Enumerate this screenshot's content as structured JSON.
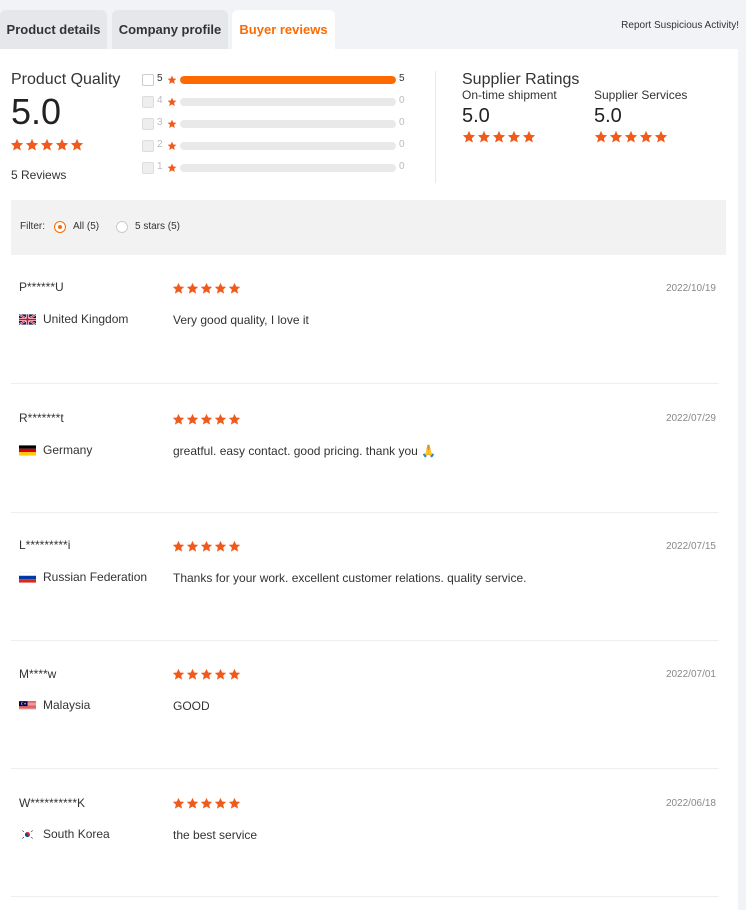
{
  "tabs": [
    {
      "label": "Product details"
    },
    {
      "label": "Company profile"
    },
    {
      "label": "Buyer reviews"
    }
  ],
  "report_link": "Report Suspicious Activity!",
  "product_quality": {
    "title": "Product Quality",
    "score": "5.0",
    "stars": 5,
    "reviews_count": "5 Reviews"
  },
  "distribution": [
    {
      "star": "5",
      "count": "5",
      "fraction": 1.0
    },
    {
      "star": "4",
      "count": "0",
      "fraction": 0
    },
    {
      "star": "3",
      "count": "0",
      "fraction": 0
    },
    {
      "star": "2",
      "count": "0",
      "fraction": 0
    },
    {
      "star": "1",
      "count": "0",
      "fraction": 0
    }
  ],
  "supplier_ratings": {
    "title": "Supplier Ratings",
    "items": [
      {
        "label": "On-time shipment",
        "score": "5.0",
        "stars": 5
      },
      {
        "label": "Supplier Services",
        "score": "5.0",
        "stars": 5
      }
    ]
  },
  "filter": {
    "label": "Filter:",
    "options": [
      {
        "label": "All (5)",
        "selected": true
      },
      {
        "label": "5 stars (5)",
        "selected": false
      }
    ]
  },
  "reviews": [
    {
      "name": "P******U",
      "country": "United Kingdom",
      "flag": "uk-flag-icon",
      "date": "2022/10/19",
      "text": "Very good quality, I love it",
      "stars": 5
    },
    {
      "name": "R*******t",
      "country": "Germany",
      "flag": "germany-flag-icon",
      "date": "2022/07/29",
      "text": "greatful. easy contact. good pricing. thank you 🙏",
      "stars": 5
    },
    {
      "name": "L*********i",
      "country": "Russian Federation",
      "flag": "russia-flag-icon",
      "date": "2022/07/15",
      "text": "Thanks for your work. excellent customer relations. quality service.",
      "stars": 5
    },
    {
      "name": "M****w",
      "country": "Malaysia",
      "flag": "malaysia-flag-icon",
      "date": "2022/07/01",
      "text": "GOOD",
      "stars": 5
    },
    {
      "name": "W**********K",
      "country": "South Korea",
      "flag": "south-korea-flag-icon",
      "date": "2022/06/18",
      "text": "the best service",
      "stars": 5
    }
  ],
  "colors": {
    "accent": "#ff6a00",
    "star": "#f05a1a"
  }
}
